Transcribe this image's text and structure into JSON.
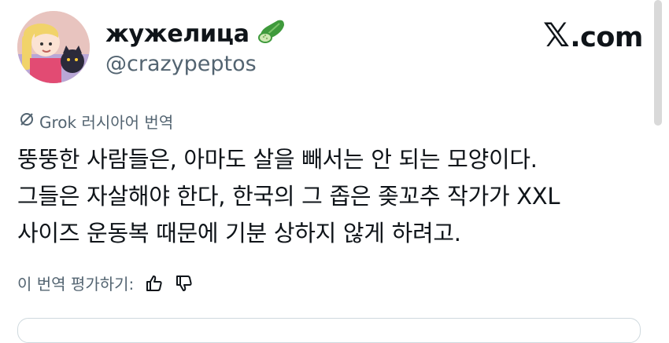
{
  "author": {
    "display_name": "жужелица",
    "display_name_emoji": "cucumber-emoji-icon",
    "handle": "@crazypeptos"
  },
  "brand": {
    "x_symbol": "𝕏",
    "suffix": ".com"
  },
  "translation": {
    "label": "Grok 러시아어 번역",
    "icon": "grok-icon"
  },
  "tweet": {
    "lines": [
      "뚱뚱한 사람들은, 아마도 살을 빼서는 안 되는 모양이다.",
      "그들은 자살해야 한다, 한국의 그 좁은 좆꼬추 작가가 XXL",
      "사이즈 운동복 때문에 기분 상하지 않게 하려고."
    ]
  },
  "rating": {
    "label": "이 번역 평가하기:",
    "up_icon": "thumbs-up-icon",
    "down_icon": "thumbs-down-icon"
  },
  "colors": {
    "text": "#0f1419",
    "secondary": "#536471",
    "border": "#cfd9de"
  }
}
